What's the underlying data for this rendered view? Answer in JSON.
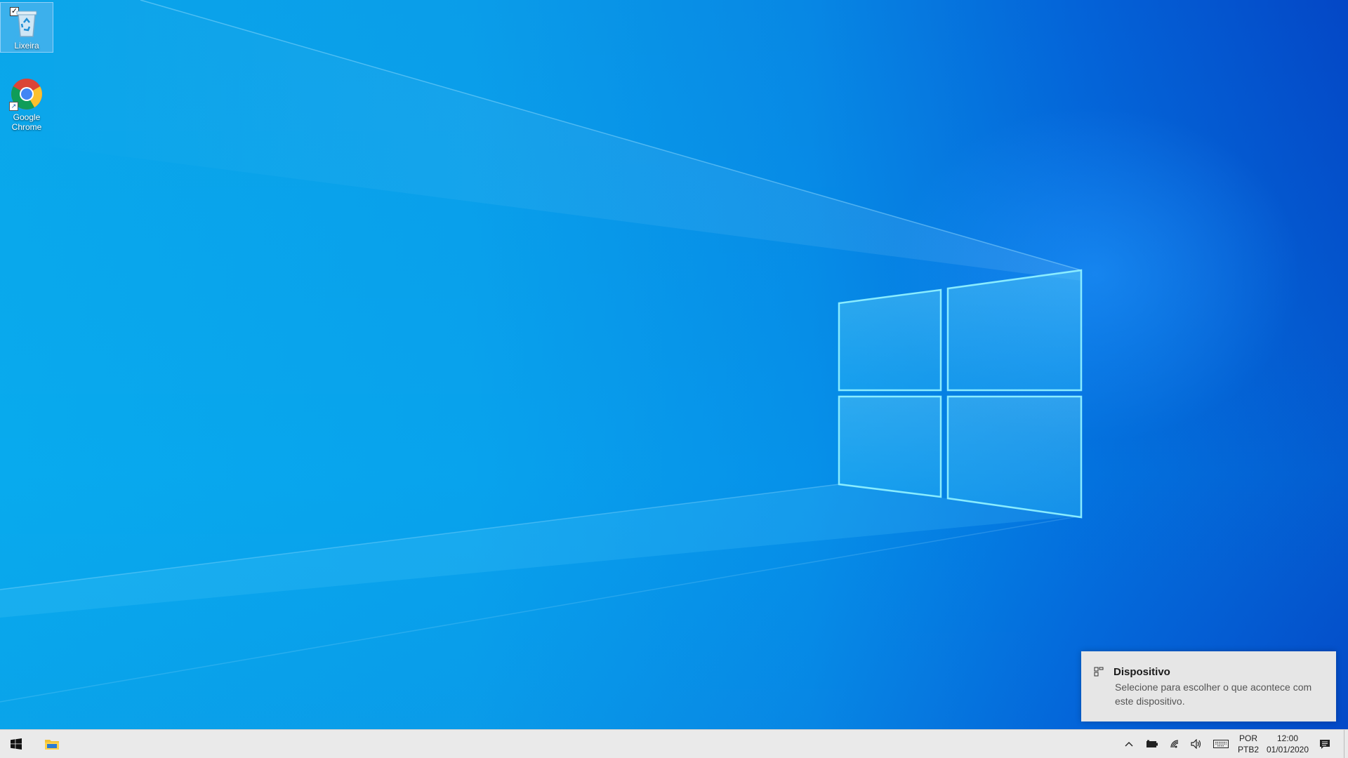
{
  "desktop": {
    "icons": [
      {
        "name": "recycle-bin",
        "label": "Lixeira",
        "selected": true
      },
      {
        "name": "google-chrome",
        "label": "Google Chrome",
        "selected": false
      }
    ]
  },
  "notification": {
    "icon": "device-icon",
    "title": "Dispositivo",
    "body": "Selecione para escolher o que acontece com este dispositivo."
  },
  "taskbar": {
    "start_icon": "windows-logo-icon",
    "pinned": [
      {
        "name": "file-explorer",
        "icon": "folder-icon"
      }
    ],
    "tray": {
      "icons": [
        "chevron-up-icon",
        "battery-icon",
        "wifi-icon",
        "volume-icon",
        "keyboard-icon"
      ],
      "language_top": "POR",
      "language_bottom": "PTB2",
      "time": "12:00",
      "date": "01/01/2020",
      "notification_icon": "action-center-icon"
    }
  },
  "colors": {
    "wallpaper_light": "#0aa6ea",
    "wallpaper_dark": "#0447c6",
    "taskbar_bg": "#eaeaea",
    "toast_bg": "#e6e6e6"
  }
}
